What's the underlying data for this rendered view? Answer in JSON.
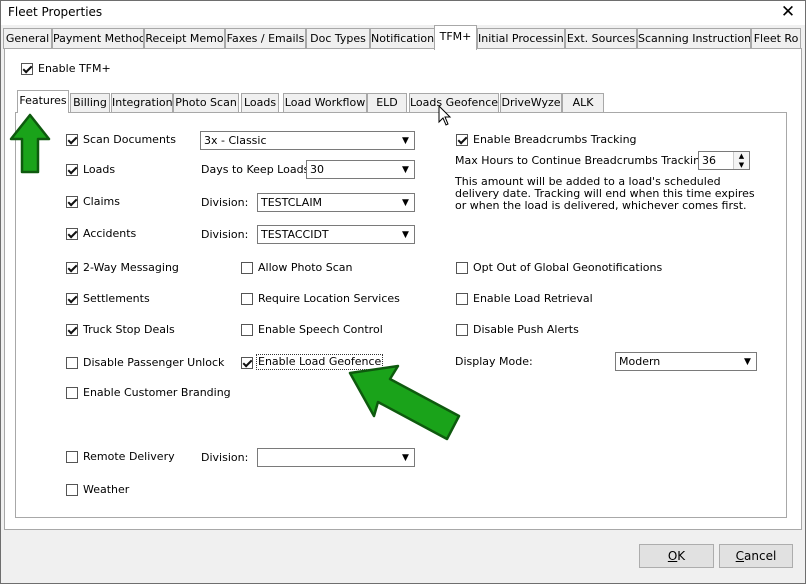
{
  "window": {
    "title": "Fleet Properties",
    "close": "✕"
  },
  "top_tabs": [
    "General",
    "Payment Method",
    "Receipt Memo",
    "Faxes / Emails",
    "Doc Types",
    "Notification",
    "TFM+",
    "Initial Processing",
    "Ext. Sources",
    "Scanning Instructions",
    "Fleet Ro"
  ],
  "top_tab_selected": "TFM+",
  "enable_tfm": {
    "label": "Enable TFM+",
    "checked": true
  },
  "inner_tabs": [
    "Features",
    "Billing",
    "Integration",
    "Photo Scan",
    "Loads",
    "Load Workflow",
    "ELD",
    "Loads Geofence",
    "DriveWyze",
    "ALK"
  ],
  "inner_tab_selected": "Features",
  "left_checks": [
    {
      "label": "Scan Documents",
      "checked": true
    },
    {
      "label": "Loads",
      "checked": true
    },
    {
      "label": "Claims",
      "checked": true
    },
    {
      "label": "Accidents",
      "checked": true
    },
    {
      "label": "2-Way Messaging",
      "checked": true
    },
    {
      "label": "Settlements",
      "checked": true
    },
    {
      "label": "Truck Stop Deals",
      "checked": true
    },
    {
      "label": "Disable Passenger Unlock",
      "checked": false
    },
    {
      "label": "Enable Customer Branding",
      "checked": false
    },
    {
      "label": "Remote Delivery",
      "checked": false
    },
    {
      "label": "Weather",
      "checked": false
    }
  ],
  "scan_documents_combo": {
    "value": "3x - Classic"
  },
  "days_to_keep": {
    "label": "Days to Keep Loads:",
    "value": "30"
  },
  "claims_division": {
    "label": "Division:",
    "value": "TESTCLAIM"
  },
  "accidents_division": {
    "label": "Division:",
    "value": "TESTACCIDT"
  },
  "remote_division": {
    "label": "Division:",
    "value": ""
  },
  "mid_checks": [
    {
      "label": "Allow Photo Scan",
      "checked": false
    },
    {
      "label": "Require Location Services",
      "checked": false
    },
    {
      "label": "Enable Speech Control",
      "checked": false
    },
    {
      "label": "Enable Load Geofence",
      "checked": true
    }
  ],
  "breadcrumbs": {
    "label": "Enable Breadcrumbs Tracking",
    "checked": true
  },
  "max_hours": {
    "label": "Max Hours to Continue Breadcrumbs Tracking:",
    "value": "36"
  },
  "help_text": "This amount will be added to a load's scheduled delivery date. Tracking will end when this time expires or when the load is delivered, whichever comes first.",
  "right_checks": [
    {
      "label": "Opt Out of Global Geonotifications",
      "checked": false
    },
    {
      "label": "Enable Load Retrieval",
      "checked": false
    },
    {
      "label": "Disable Push Alerts",
      "checked": false
    }
  ],
  "display_mode": {
    "label": "Display Mode:",
    "value": "Modern"
  },
  "buttons": {
    "ok": "OK",
    "cancel": "Cancel"
  },
  "colors": {
    "arrow_green": "#1aa31a",
    "arrow_dark": "#0e5a0e"
  }
}
